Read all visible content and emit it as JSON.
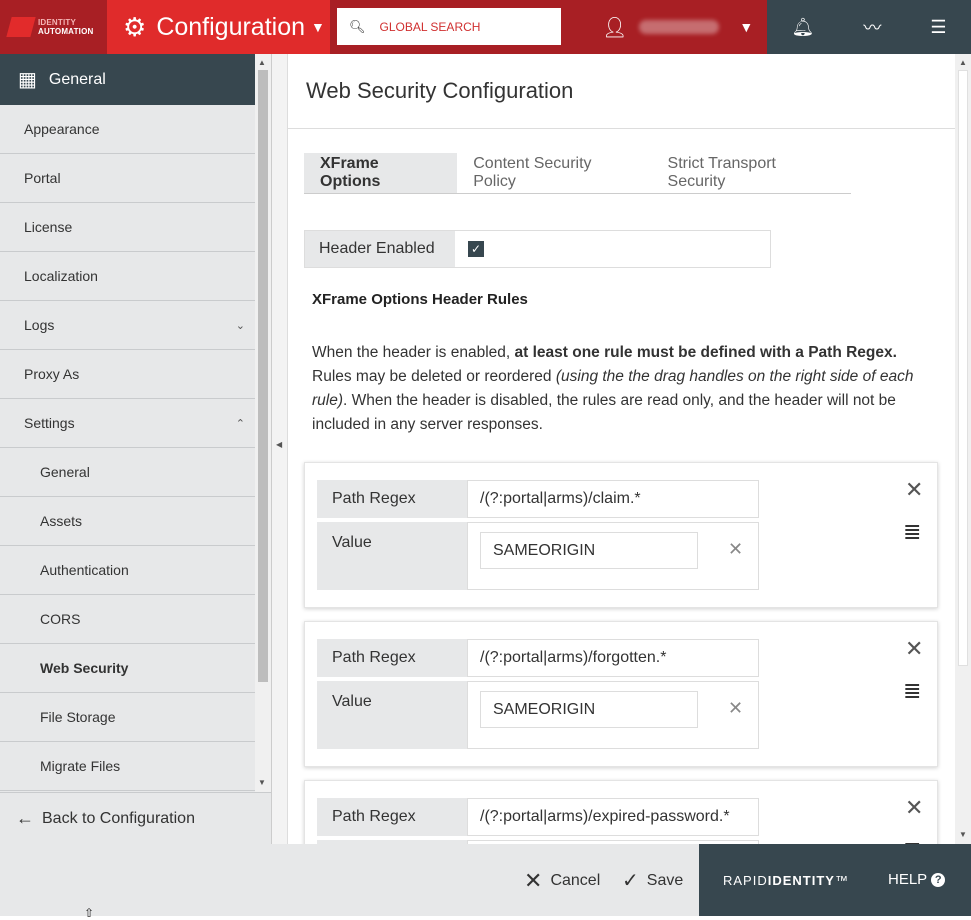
{
  "brand": {
    "logo_line1": "IDENTITY",
    "logo_line2": "AUTOMATION",
    "product_a": "RAPID",
    "product_b": "IDENTITY",
    "trademark": "™"
  },
  "header": {
    "app_title": "Configuration",
    "search_placeholder": "GLOBAL SEARCH"
  },
  "sidebar": {
    "section_title": "General",
    "items": [
      {
        "label": "Appearance"
      },
      {
        "label": "Portal"
      },
      {
        "label": "License"
      },
      {
        "label": "Localization"
      },
      {
        "label": "Logs"
      },
      {
        "label": "Proxy As"
      },
      {
        "label": "Settings"
      },
      {
        "label": "General"
      },
      {
        "label": "Assets"
      },
      {
        "label": "Authentication"
      },
      {
        "label": "CORS"
      },
      {
        "label": "Web Security"
      },
      {
        "label": "File Storage"
      },
      {
        "label": "Migrate Files"
      }
    ],
    "back_label": "Back to Configuration"
  },
  "main": {
    "title": "Web Security Configuration",
    "tabs": [
      {
        "label": "XFrame Options",
        "active": true
      },
      {
        "label": "Content Security Policy"
      },
      {
        "label": "Strict Transport Security"
      }
    ],
    "header_enabled_label": "Header Enabled",
    "header_enabled": true,
    "rules_title": "XFrame Options Header Rules",
    "desc": {
      "p1": "When the header is enabled, ",
      "b1": "at least one rule must be defined with a Path Regex.",
      "p2": " Rules may be deleted or reordered ",
      "i1": "(using the the drag handles on the right side of each rule)",
      "p3": ". When the header is disabled, the rules are read only, and the header will not be included in any server responses."
    },
    "path_regex_label": "Path Regex",
    "value_label": "Value",
    "rules": [
      {
        "path_regex": "/(?:portal|arms)/claim.*",
        "value": "SAMEORIGIN"
      },
      {
        "path_regex": "/(?:portal|arms)/forgotten.*",
        "value": "SAMEORIGIN"
      },
      {
        "path_regex": "/(?:portal|arms)/expired-password.*",
        "value": ""
      }
    ]
  },
  "footer": {
    "cancel_label": "Cancel",
    "save_label": "Save",
    "help_label": "HELP"
  },
  "colors": {
    "header_red": "#a81f24",
    "accent_red": "#e02b2b",
    "dark_slate": "#37474f",
    "panel_gray": "#e7e8e9"
  }
}
